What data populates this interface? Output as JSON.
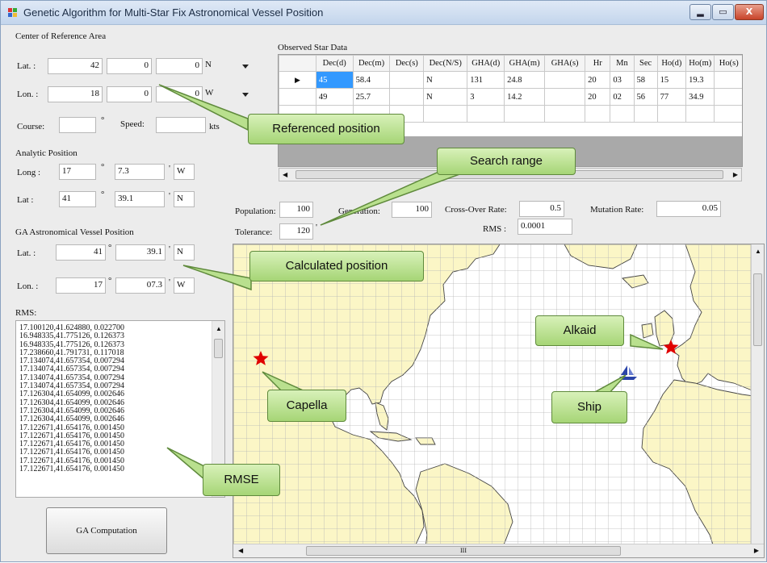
{
  "window": {
    "title": "Genetic Algorithm for Multi-Star Fix Astronomical Vessel Position",
    "controls": {
      "minimize": "▂",
      "maximize": "▭",
      "close": "X"
    }
  },
  "center": {
    "heading": "Center of Reference Area",
    "lat": {
      "label": "Lat. :",
      "deg": "42",
      "min": "0",
      "sec": "0",
      "hem": "N"
    },
    "lon": {
      "label": "Lon. :",
      "deg": "18",
      "min": "0",
      "sec": "0",
      "hem": "W"
    },
    "course_label": "Course:",
    "course_unit": "°",
    "speed_label": "Speed:",
    "speed_unit": "kts"
  },
  "analytic": {
    "heading": "Analytic Position",
    "long_label": "Long :",
    "long_deg": "17",
    "long_deg_unit": "°",
    "long_min": "7.3",
    "long_min_unit": "'",
    "long_hem": "W",
    "lat_label": "Lat :",
    "lat_deg": "41",
    "lat_deg_unit": "°",
    "lat_min": "39.1",
    "lat_min_unit": "'",
    "lat_hem": "N"
  },
  "ga": {
    "heading": "GA Astronomical Vessel Position",
    "lat_label": "Lat. :",
    "lat_deg": "41",
    "lat_deg_unit": "°",
    "lat_min": "39.1",
    "lat_min_unit": "'",
    "lat_hem": "N",
    "lon_label": "Lon. :",
    "lon_deg": "17",
    "lon_deg_unit": "°",
    "lon_min": "07.3",
    "lon_min_unit": "'",
    "lon_hem": "W"
  },
  "rms": {
    "label": "RMS:",
    "lines": [
      "17.100120,41.624880, 0.022700",
      "16.948335,41.775126, 0.126373",
      "16.948335,41.775126, 0.126373",
      "17.238660,41.791731, 0.117018",
      "17.134074,41.657354, 0.007294",
      "17.134074,41.657354, 0.007294",
      "17.134074,41.657354, 0.007294",
      "17.134074,41.657354, 0.007294",
      "17.126304,41.654099, 0.002646",
      "17.126304,41.654099, 0.002646",
      "17.126304,41.654099, 0.002646",
      "17.126304,41.654099, 0.002646",
      "17.122671,41.654176, 0.001450",
      "17.122671,41.654176, 0.001450",
      "17.122671,41.654176, 0.001450",
      "17.122671,41.654176, 0.001450",
      "17.122671,41.654176, 0.001450",
      "17.122671,41.654176, 0.001450"
    ]
  },
  "compute_button": "GA Computation",
  "star_data": {
    "heading": "Observed Star Data",
    "columns": [
      "Dec(d)",
      "Dec(m)",
      "Dec(s)",
      "Dec(N/S)",
      "GHA(d)",
      "GHA(m)",
      "GHA(s)",
      "Hr",
      "Mn",
      "Sec",
      "Ho(d)",
      "Ho(m)",
      "Ho(s)"
    ],
    "rows": [
      [
        "45",
        "58.4",
        "",
        "N",
        "131",
        "24.8",
        "",
        "20",
        "03",
        "58",
        "15",
        "19.3",
        ""
      ],
      [
        "49",
        "25.7",
        "",
        "N",
        "3",
        "14.2",
        "",
        "20",
        "02",
        "56",
        "77",
        "34.9",
        ""
      ]
    ],
    "row_marker": "▶"
  },
  "params": {
    "population_label": "Population:",
    "population": "100",
    "generation_label": "Generation:",
    "generation": "100",
    "crossover_label": "Cross-Over Rate:",
    "crossover": "0.5",
    "mutation_label": "Mutation Rate:",
    "mutation": "0.05",
    "tolerance_label": "Tolerance:",
    "tolerance": "120",
    "tolerance_unit": "'",
    "rms_label": "RMS :",
    "rms_value": "0.0001"
  },
  "annotations": {
    "referenced": "Referenced position",
    "search": "Search range",
    "calculated": "Calculated position",
    "alkaid": "Alkaid",
    "capella": "Capella",
    "ship": "Ship",
    "rmse": "RMSE"
  },
  "map": {
    "scroll_center": "III",
    "colors": {
      "land": "#fbf6c6",
      "sea": "#ffffff",
      "grid": "#b5b5b5",
      "star": "#e00000",
      "ship": "#2a44a8"
    }
  }
}
